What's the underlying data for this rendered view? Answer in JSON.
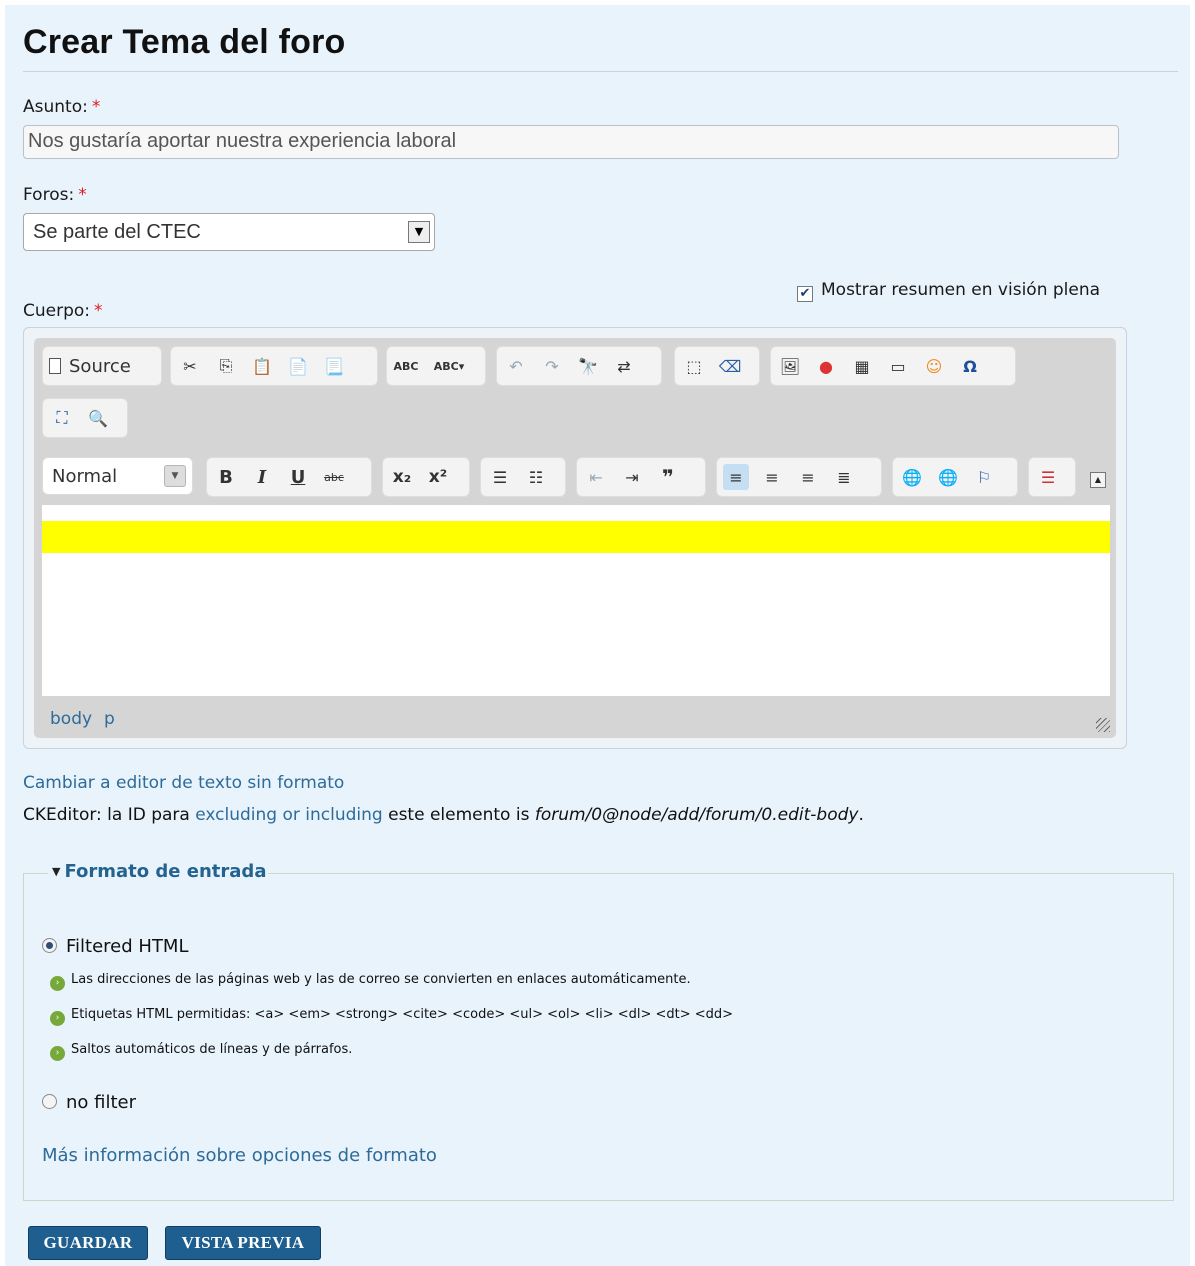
{
  "page": {
    "title": "Crear Tema del foro"
  },
  "subject": {
    "label": "Asunto:",
    "required_mark": "*",
    "value": "Nos gustaría aportar nuestra experiencia laboral"
  },
  "forums": {
    "label": "Foros:",
    "required_mark": "*",
    "selected": "Se parte del CTEC"
  },
  "teaser_checkbox": {
    "label": "Mostrar resumen en visión plena",
    "checked": true
  },
  "body": {
    "label": "Cuerpo:",
    "required_mark": "*"
  },
  "editor": {
    "source_label": "Source",
    "format_selected": "Normal",
    "path": [
      "body",
      "p"
    ],
    "icons": {
      "cut": "scissors-icon",
      "copy": "copy-icon",
      "paste": "paste-icon",
      "paste_text": "paste-text-icon",
      "paste_word": "paste-word-icon",
      "spellcheck": "spellcheck-icon",
      "scayt": "scayt-icon",
      "undo": "undo-icon",
      "redo": "redo-icon",
      "find": "find-icon",
      "replace": "replace-icon",
      "select_all": "select-all-icon",
      "remove_format": "eraser-icon",
      "image": "image-icon",
      "flash": "flash-icon",
      "table": "table-icon",
      "horizontal_rule": "horizontal-rule-icon",
      "smiley": "smiley-icon",
      "special_char": "omega-icon",
      "maximize": "maximize-icon",
      "show_blocks": "show-blocks-icon",
      "bold": "B",
      "italic": "I",
      "underline": "U",
      "strike": "abc",
      "subscript": "x₂",
      "superscript": "x²",
      "numbered_list": "numbered-list-icon",
      "bulleted_list": "bulleted-list-icon",
      "outdent": "outdent-icon",
      "indent": "indent-icon",
      "blockquote": "blockquote-icon",
      "link": "link-icon",
      "unlink": "unlink-icon",
      "anchor": "anchor-flag-icon",
      "page_break": "page-break-icon"
    },
    "highlight_color": "#ffff00"
  },
  "plain_text_link": "Cambiar a editor de texto sin formato",
  "ckeditor_note": {
    "prefix": "CKEditor: la ID para ",
    "link": "excluding or including",
    "middle": " este elemento is ",
    "id": "forum/0@node/add/forum/0.edit-body",
    "suffix": "."
  },
  "input_format": {
    "legend": "Formato de entrada",
    "options": [
      {
        "label": "Filtered HTML",
        "selected": true
      },
      {
        "label": "no filter",
        "selected": false
      }
    ],
    "tips": [
      "Las direcciones de las páginas web y las de correo se convierten en enlaces automáticamente.",
      "Etiquetas HTML permitidas: <a> <em> <strong> <cite> <code> <ul> <ol> <li> <dl> <dt> <dd>",
      "Saltos automáticos de líneas y de párrafos."
    ],
    "more_info": "Más información sobre opciones de formato"
  },
  "buttons": {
    "save": "GUARDAR",
    "preview": "VISTA PREVIA"
  },
  "colors": {
    "background": "#e9f3fc",
    "link": "#2d6b99",
    "button": "#1f5f8f",
    "required": "#e01b1b"
  }
}
